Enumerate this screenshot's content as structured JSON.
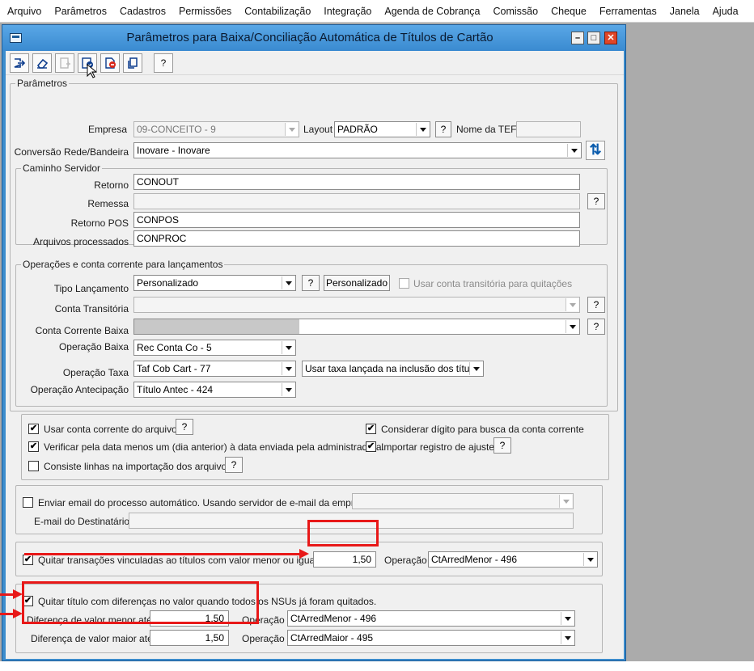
{
  "menu": [
    "Arquivo",
    "Parâmetros",
    "Cadastros",
    "Permissões",
    "Contabilização",
    "Integração",
    "Agenda de Cobrança",
    "Comissão",
    "Cheque",
    "Ferramentas",
    "Janela",
    "Ajuda"
  ],
  "window": {
    "title": "Parâmetros para Baixa/Conciliação Automática de Títulos de Cartão"
  },
  "toolbar": {
    "help_label": "?"
  },
  "parametros": {
    "legend": "Parâmetros",
    "empresa_label": "Empresa",
    "empresa_value": "09-CONCEITO - 9",
    "layout_label": "Layout",
    "layout_value": "PADRÃO",
    "help_label": "?",
    "nome_tef_label": "Nome da TEF",
    "nome_tef_value": "",
    "conversao_label": "Conversão Rede/Bandeira",
    "conversao_value": "Inovare - Inovare"
  },
  "caminho": {
    "legend": "Caminho Servidor",
    "retorno_label": "Retorno",
    "retorno_value": "CONOUT",
    "remessa_label": "Remessa",
    "remessa_value": "",
    "retorno_pos_label": "Retorno POS",
    "retorno_pos_value": "CONPOS",
    "arquivos_label": "Arquivos processados",
    "arquivos_value": "CONPROC",
    "help_label": "?"
  },
  "operacoes": {
    "legend": "Operações e conta corrente para lançamentos",
    "tipo_label": "Tipo Lançamento",
    "tipo_value": "Personalizado",
    "help_label": "?",
    "personalizado_button": "Personalizado",
    "usar_transitoria_label": "Usar conta transitória para quitações",
    "usar_transitoria_checked": false,
    "conta_transitoria_label": "Conta Transitória",
    "conta_transitoria_value": "",
    "conta_corrente_label": "Conta Corrente Baixa",
    "conta_corrente_value": "",
    "operacao_baixa_label": "Operação Baixa",
    "operacao_baixa_value": "Rec Conta Co - 5",
    "operacao_taxa_label": "Operação Taxa",
    "operacao_taxa_value": "Taf Cob Cart - 77",
    "usar_taxa_value": "Usar taxa lançada na inclusão dos título",
    "operacao_antecipacao_label": "Operação Antecipação",
    "operacao_antecipacao_value": "Título Antec - 424"
  },
  "opcoes": {
    "usar_conta_label": "Usar conta corrente do arquivo",
    "usar_conta_checked": true,
    "considerar_label": "Considerar dígito para busca da conta corrente",
    "considerar_checked": true,
    "verificar_label": "Verificar pela data menos um (dia anterior) à data enviada pela administradora.",
    "verificar_checked": true,
    "importar_label": "Importar registro de ajuste",
    "importar_checked": true,
    "consiste_label": "Consiste linhas na importação dos arquivos",
    "consiste_checked": false,
    "help_label": "?",
    "check_mark": "✔"
  },
  "email": {
    "enviar_label": "Enviar email do processo automático. Usando servidor de e-mail da empresa",
    "enviar_checked": false,
    "servidor_value": "",
    "destinatario_label": "E-mail do Destinatário",
    "destinatario_value": ""
  },
  "quitar": {
    "label": "Quitar transações vinculadas ao títulos com valor menor ou igual a",
    "checked": true,
    "valor": "1,50",
    "operacao_label": "Operação",
    "operacao_value": "CtArredMenor - 496"
  },
  "diferencas": {
    "label": "Quitar título com diferenças no valor quando todos os NSUs já foram quitados.",
    "checked": true,
    "menor_label": "Diferença de valor menor até",
    "menor_valor": "1,50",
    "menor_operacao_label": "Operação",
    "menor_operacao_value": "CtArredMenor - 496",
    "maior_label": "Diferença de valor maior até",
    "maior_valor": "1,50",
    "maior_operacao_label": "Operação",
    "maior_operacao_value": "CtArredMaior - 495"
  },
  "colors": {
    "highlight": "#e81818",
    "window_frame": "#3c8ccc"
  }
}
